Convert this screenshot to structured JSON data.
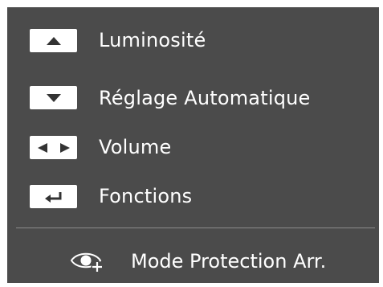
{
  "menu": {
    "items": [
      {
        "icon": "up-arrow-icon",
        "label": "Luminosité"
      },
      {
        "icon": "down-arrow-icon",
        "label": "Réglage Automatique"
      },
      {
        "icon": "left-right-arrows-icon",
        "label": "Volume"
      },
      {
        "icon": "return-enter-icon",
        "label": "Fonctions"
      }
    ],
    "bottom": {
      "icon": "eye-plus-icon",
      "label": "Mode Protection Arr."
    }
  },
  "colors": {
    "panel": "#4b4b4b",
    "text": "#ffffff",
    "key": "#ffffff",
    "divider": "#8c8c8c"
  }
}
